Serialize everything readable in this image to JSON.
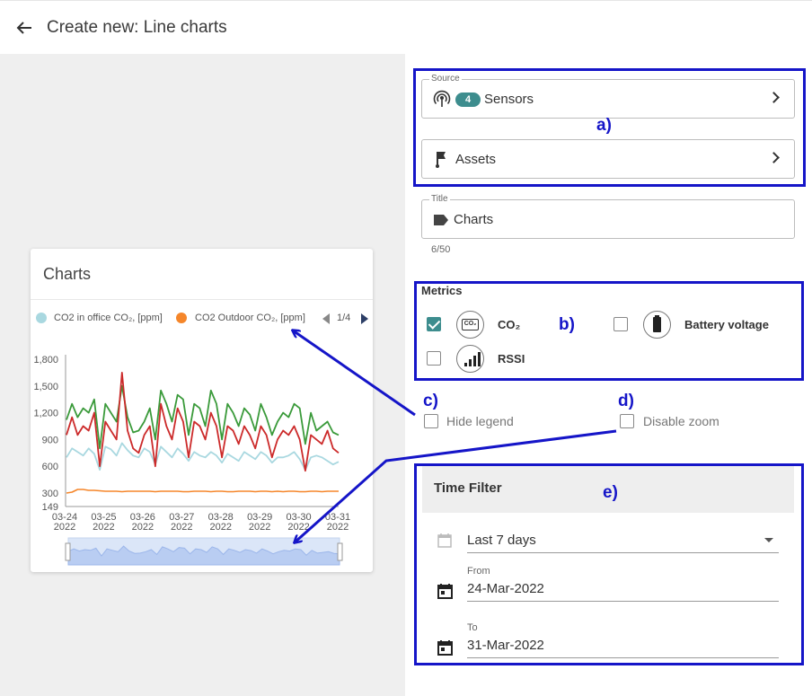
{
  "header": {
    "title": "Create new: Line charts"
  },
  "preview": {
    "card_title": "Charts",
    "legend": {
      "items": [
        {
          "label": "CO2 in office CO₂, [ppm]",
          "color": "#a9d8e0"
        },
        {
          "label": "CO2 Outdoor CO₂, [ppm]",
          "color": "#f5862a"
        }
      ],
      "page": "1/4"
    }
  },
  "source": {
    "label": "Source",
    "sensors_count": "4",
    "sensors_label": "Sensors",
    "assets_label": "Assets"
  },
  "title_field": {
    "label": "Title",
    "value": "Charts",
    "counter": "6/50"
  },
  "metrics": {
    "heading": "Metrics",
    "items": [
      {
        "label": "CO₂",
        "checked": true,
        "icon": "co2-icon"
      },
      {
        "label": "Battery voltage",
        "checked": false,
        "icon": "battery-icon"
      },
      {
        "label": "RSSI",
        "checked": false,
        "icon": "signal-bars-icon"
      }
    ]
  },
  "options": {
    "hide_legend": "Hide legend",
    "disable_zoom": "Disable zoom"
  },
  "time_filter": {
    "heading": "Time Filter",
    "range": "Last 7 days",
    "from_label": "From",
    "from_value": "24-Mar-2022",
    "to_label": "To",
    "to_value": "31-Mar-2022"
  },
  "annotations": {
    "a": "a)",
    "b": "b)",
    "c": "c)",
    "d": "d)",
    "e": "e)"
  },
  "colors": {
    "accent": "#3d8d8e",
    "annotation": "#1515c8",
    "series_green": "#3a9a3a",
    "series_red": "#cc2a2a"
  },
  "chart_data": {
    "type": "line",
    "title": "Charts",
    "x_ticks": [
      "03-24 2022",
      "03-25 2022",
      "03-26 2022",
      "03-27 2022",
      "03-28 2022",
      "03-29 2022",
      "03-30 2022",
      "03-31 2022"
    ],
    "y_ticks": [
      149,
      300,
      600,
      900,
      1200,
      1500,
      1800
    ],
    "ylim": [
      149,
      1800
    ],
    "series": [
      {
        "name": "CO2 in office CO₂, [ppm]",
        "color": "#a9d8e0",
        "values": [
          700,
          800,
          760,
          720,
          800,
          740,
          560,
          820,
          790,
          720,
          860,
          780,
          720,
          700,
          800,
          760,
          620,
          820,
          760,
          700,
          800,
          740,
          660,
          760,
          720,
          700,
          760,
          720,
          640,
          740,
          700,
          660,
          760,
          720,
          680,
          760,
          720,
          640,
          700,
          700,
          720,
          760,
          680,
          560,
          700,
          720,
          700,
          660,
          620,
          650
        ]
      },
      {
        "name": "CO2 Outdoor CO₂, [ppm]",
        "color": "#f5862a",
        "values": [
          300,
          310,
          340,
          340,
          330,
          330,
          325,
          320,
          320,
          320,
          315,
          320,
          320,
          320,
          320,
          320,
          315,
          320,
          320,
          320,
          320,
          315,
          315,
          320,
          320,
          320,
          315,
          320,
          320,
          315,
          315,
          320,
          320,
          320,
          315,
          320,
          320,
          315,
          320,
          315,
          320,
          320,
          315,
          315,
          320,
          320,
          315,
          320,
          320,
          320
        ]
      },
      {
        "color": "#3a9a3a",
        "values": [
          1120,
          1300,
          1150,
          1250,
          1200,
          1350,
          800,
          1300,
          1200,
          1100,
          1500,
          1150,
          980,
          1000,
          1100,
          1250,
          900,
          1450,
          1300,
          1100,
          1400,
          1350,
          950,
          1300,
          1250,
          1050,
          1450,
          1300,
          900,
          1300,
          1200,
          1050,
          1250,
          1180,
          1000,
          1300,
          1150,
          950,
          1100,
          1200,
          1150,
          1300,
          1250,
          850,
          1200,
          1000,
          1050,
          1100,
          980,
          950
        ]
      },
      {
        "color": "#cc2a2a",
        "values": [
          950,
          1150,
          950,
          1050,
          1000,
          1200,
          600,
          1100,
          1000,
          900,
          1650,
          1000,
          800,
          750,
          950,
          1050,
          600,
          1300,
          1050,
          900,
          1250,
          1100,
          700,
          1100,
          1050,
          900,
          1200,
          1050,
          700,
          1050,
          1000,
          850,
          1050,
          950,
          800,
          1050,
          950,
          700,
          900,
          1000,
          950,
          1050,
          900,
          550,
          950,
          900,
          850,
          1000,
          800,
          750
        ]
      }
    ],
    "grid": false,
    "legend": "top"
  }
}
